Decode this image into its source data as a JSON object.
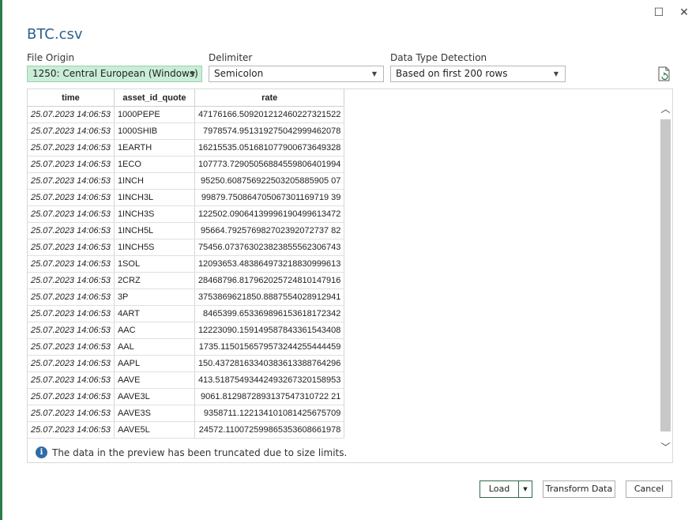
{
  "window": {
    "title": "BTC.csv",
    "maximize_glyph": "☐",
    "close_glyph": "✕"
  },
  "options": {
    "file_origin": {
      "label": "File Origin",
      "value": "1250: Central European (Windows)"
    },
    "delimiter": {
      "label": "Delimiter",
      "value": "Semicolon"
    },
    "detection": {
      "label": "Data Type Detection",
      "value": "Based on first 200 rows"
    }
  },
  "table": {
    "headers": [
      "time",
      "asset_id_quote",
      "rate"
    ],
    "rows": [
      [
        "25.07.2023 14:06:53",
        "1000PEPE",
        "47176166.509201212460227321522"
      ],
      [
        "25.07.2023 14:06:53",
        "1000SHIB",
        "7978574.951319275042999462078"
      ],
      [
        "25.07.2023 14:06:53",
        "1EARTH",
        "16215535.051681077900673649328"
      ],
      [
        "25.07.2023 14:06:53",
        "1ECO",
        "107773.72905056884559806401994"
      ],
      [
        "25.07.2023 14:06:53",
        "1INCH",
        "95250.608756922503205885905 07"
      ],
      [
        "25.07.2023 14:06:53",
        "1INCH3L",
        "99879.750864705067301169719 39"
      ],
      [
        "25.07.2023 14:06:53",
        "1INCH3S",
        "122502.09064139996190499613472"
      ],
      [
        "25.07.2023 14:06:53",
        "1INCH5L",
        "95664.792576982702392072737 82"
      ],
      [
        "25.07.2023 14:06:53",
        "1INCH5S",
        "75456.073763023823855562306743"
      ],
      [
        "25.07.2023 14:06:53",
        "1SOL",
        "12093653.483864973218830999613"
      ],
      [
        "25.07.2023 14:06:53",
        "2CRZ",
        "28468796.817962025724810147916"
      ],
      [
        "25.07.2023 14:06:53",
        "3P",
        "3753869621850.8887554028912941"
      ],
      [
        "25.07.2023 14:06:53",
        "4ART",
        "8465399.653369896153618172342"
      ],
      [
        "25.07.2023 14:06:53",
        "AAC",
        "12223090.159149587843361543408"
      ],
      [
        "25.07.2023 14:06:53",
        "AAL",
        "1735.1150156579573244255444459"
      ],
      [
        "25.07.2023 14:06:53",
        "AAPL",
        "150.43728163340383613388764296"
      ],
      [
        "25.07.2023 14:06:53",
        "AAVE",
        "413.51875493442493267320158953"
      ],
      [
        "25.07.2023 14:06:53",
        "AAVE3L",
        "9061.8129872893137547310722 21"
      ],
      [
        "25.07.2023 14:06:53",
        "AAVE3S",
        "9358711.122134101081425675709"
      ],
      [
        "25.07.2023 14:06:53",
        "AAVE5L",
        "24572.110072599865353608661978"
      ]
    ]
  },
  "notice": {
    "icon": "i",
    "text": "The data in the preview has been truncated due to size limits."
  },
  "buttons": {
    "load": "Load",
    "transform": "Transform Data",
    "cancel": "Cancel"
  },
  "glyphs": {
    "dropdown": "▼",
    "up": "︿",
    "down": "﹀"
  }
}
